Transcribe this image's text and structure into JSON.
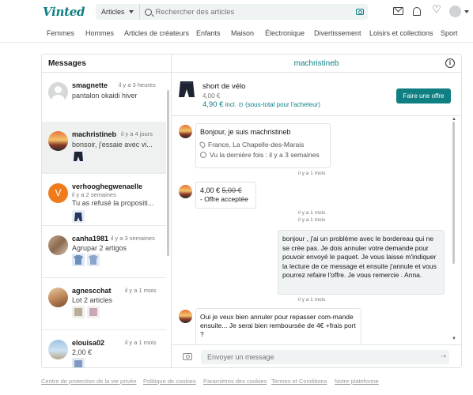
{
  "header": {
    "logo": "Vinted",
    "category_select": "Articles",
    "search_placeholder": "Rechercher des articles"
  },
  "nav": {
    "items": [
      "Femmes",
      "Hommes",
      "Articles de créateurs",
      "Enfants",
      "Maison",
      "Électronique",
      "Divertissement",
      "Loisirs et collections",
      "Sport"
    ]
  },
  "left": {
    "title": "Messages",
    "conversations": [
      {
        "name": "smagnette",
        "time": "il y a 3 heures",
        "preview": "pantalon okaidi hiver"
      },
      {
        "name": "machristineb",
        "time": "il y a 4 jours",
        "preview": "bonsoir, j'essaie avec vi..."
      },
      {
        "name": "verhooghegwenaelle",
        "time": "il y a 2 semaines",
        "preview": "Tu as refusé la propositi...",
        "avatar_letter": "V"
      },
      {
        "name": "canha1981",
        "time": "il y a 3 semaines",
        "preview": "Agrupar 2 artigos"
      },
      {
        "name": "agnescchat",
        "time": "il y a 1 mois",
        "preview": "Lot 2 articles"
      },
      {
        "name": "elouisa02",
        "time": "il y a 1 mois",
        "preview": "2,00 €"
      }
    ]
  },
  "right": {
    "title": "machristineb",
    "item": {
      "title": "short de vélo",
      "price": "4,00 €",
      "total": "4,90 €",
      "total_note": "incl.",
      "total_suffix": "(sous-total pour l'acheteur)",
      "offer_button": "Faire une offre"
    },
    "messages": {
      "intro_title": "Bonjour, je suis machristineb",
      "intro_location": "France, La Chapelle-des-Marais",
      "intro_seen": "Vu la dernière fois : il y a 3 semaines",
      "ts1": "il y a 1 mois",
      "offer_new": "4,00 €",
      "offer_old": "5,00 €",
      "offer_status": "- Offre acceptée",
      "ts2": "il y a 1 mois",
      "ts3": "il y a 1 mois",
      "me_text": "bonjour , j'ai un problème avec le bordereau qui ne se crée pas. Je dois annuler votre demande pour pouvoir envoyé le paquet. Je vous laisse m'indiquer la lecture de ce message et ensuite j'annule et vous pourrez refaire l'offre. Je vous remercie . Anna.",
      "ts4": "il y a 1 mois",
      "reply_text": "Oui je veux bien annuler pour repasser com-mande ensuite... Je serai bien remboursée de 4€ +frais port ?"
    },
    "compose_placeholder": "Envoyer un message"
  },
  "footer": {
    "links": [
      "Centre de protection de la vie privée",
      "Politique de cookies",
      "Paramètres des cookies",
      "Termes et Conditions",
      "Notre plateforme"
    ]
  },
  "colors": {
    "brand": "#0f7f82",
    "scrollbar": "#c7c9ca",
    "avatar_v": "#f07b1c"
  }
}
